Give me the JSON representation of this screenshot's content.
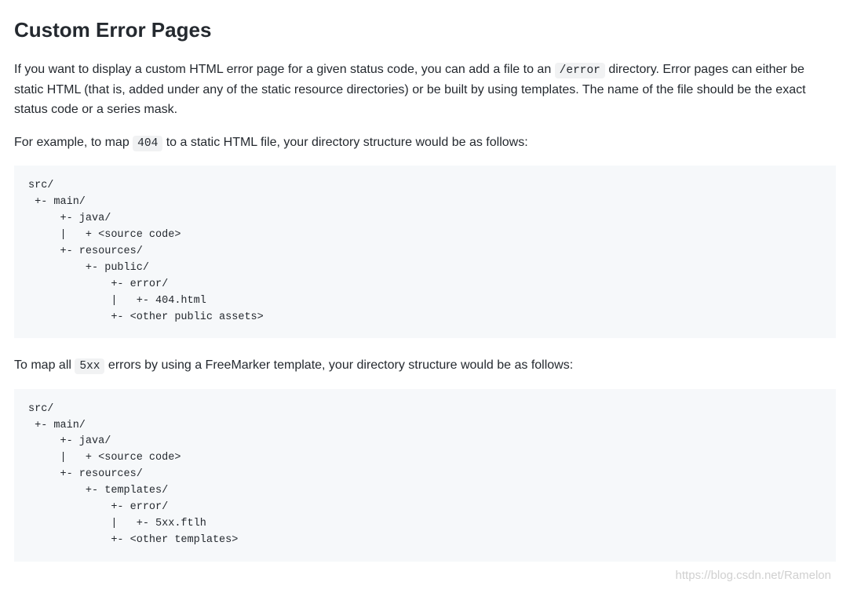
{
  "heading": "Custom Error Pages",
  "para1_a": "If you want to display a custom HTML error page for a given status code, you can add a file to an ",
  "para1_code": "/error",
  "para1_b": " directory. Error pages can either be static HTML (that is, added under any of the static resource directories) or be built by using templates. The name of the file should be the exact status code or a series mask.",
  "para2_a": "For example, to map ",
  "para2_code": "404",
  "para2_b": " to a static HTML file, your directory structure would be as follows:",
  "codeblock1": "src/\n +- main/\n     +- java/\n     |   + <source code>\n     +- resources/\n         +- public/\n             +- error/\n             |   +- 404.html\n             +- <other public assets>",
  "para3_a": "To map all ",
  "para3_code": "5xx",
  "para3_b": " errors by using a FreeMarker template, your directory structure would be as follows:",
  "codeblock2": "src/\n +- main/\n     +- java/\n     |   + <source code>\n     +- resources/\n         +- templates/\n             +- error/\n             |   +- 5xx.ftlh\n             +- <other templates>",
  "watermark": "https://blog.csdn.net/Ramelon"
}
